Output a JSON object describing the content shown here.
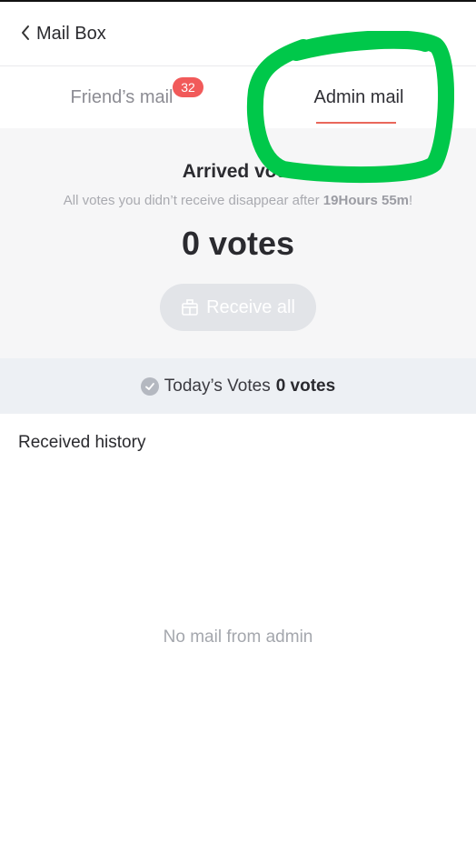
{
  "header": {
    "title": "Mail Box"
  },
  "tabs": [
    {
      "label": "Friend’s mail",
      "badge": "32",
      "active": false
    },
    {
      "label": "Admin mail",
      "active": true
    }
  ],
  "summary": {
    "title": "Arrived vote",
    "note_prefix": "All votes you didn’t receive disappear after ",
    "note_time": "19Hours 55m",
    "note_suffix": "!",
    "votes_total": "0 votes",
    "receive_all_label": "Receive all"
  },
  "today": {
    "label": "Today’s Votes",
    "value": "0 votes"
  },
  "history": {
    "title": "Received history",
    "empty_message": "No mail from admin"
  },
  "colors": {
    "accent": "#e9675b",
    "badge": "#f15a5a",
    "annotation": "#00c84a"
  },
  "icons": {
    "back": "chevron-left-icon",
    "receive": "gift-box-icon",
    "check": "check-circle-icon"
  }
}
